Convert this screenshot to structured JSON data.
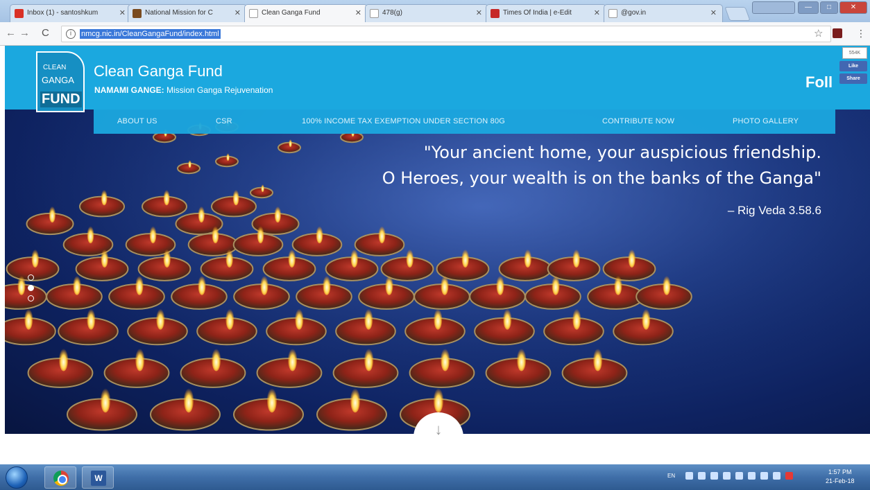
{
  "browser": {
    "tabs": [
      {
        "title": "Inbox (1) - santoshkum",
        "favicon_color": "#d93025"
      },
      {
        "title": "National Mission for C",
        "favicon_color": "#7a4b1f"
      },
      {
        "title": "Clean Ganga Fund",
        "favicon_color": "#e0e0e0"
      },
      {
        "title": "478(g)",
        "favicon_color": "#e0e0e0"
      },
      {
        "title": "Times Of India | e-Edit",
        "favicon_color": "#c62828"
      },
      {
        "title": "@gov.in",
        "favicon_color": "#e0e0e0"
      }
    ],
    "window_controls": {
      "minimize": "—",
      "maximize": "□",
      "close": "✕"
    },
    "url": "nmcg.nic.in/CleanGangaFund/index.html"
  },
  "site": {
    "logo": {
      "line1": "CLEAN",
      "line2": "GANGA",
      "line3": "FUND"
    },
    "title": "Clean Ganga Fund",
    "subtitle_bold": "NAMAMI GANGE:",
    "subtitle_rest": " Mission Ganga Rejuvenation",
    "follow": "Foll",
    "social": {
      "count": "554K",
      "like": "Like",
      "share": "Share"
    }
  },
  "nav": [
    "ABOUT US",
    "CSR",
    "100% INCOME TAX EXEMPTION UNDER SECTION 80G",
    "CONTRIBUTE NOW",
    "PHOTO GALLERY"
  ],
  "hero": {
    "quote_line1": "\"Your ancient home, your auspicious friendship.",
    "quote_line2": "O Heroes, your wealth is on the banks of the Ganga\"",
    "citation": "– Rig Veda 3.58.6",
    "slides": 3,
    "active_slide": 2,
    "scroll_icon": "arrow-down-icon"
  },
  "taskbar": {
    "language": "EN",
    "time": "1:57 PM",
    "date": "21-Feb-18"
  },
  "colors": {
    "brand_blue": "#1ba8df",
    "logo_blue": "#168fc3",
    "river_blue": "#1d3a85"
  }
}
